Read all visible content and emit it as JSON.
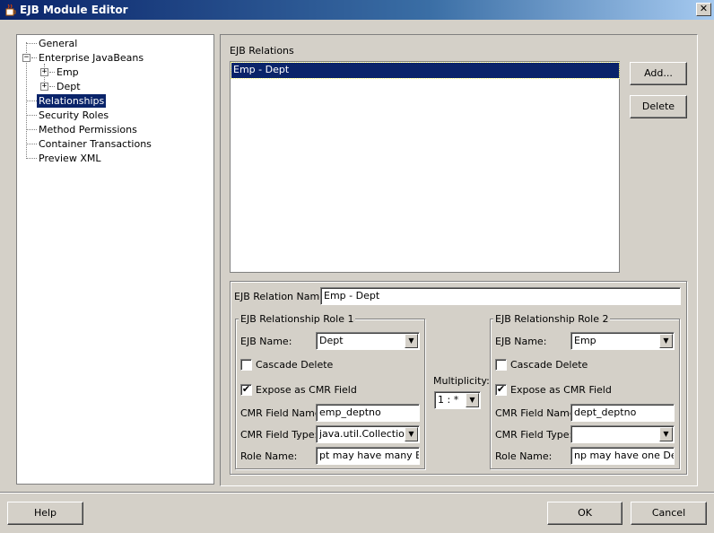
{
  "window": {
    "title": "EJB Module Editor",
    "close_glyph": "✕"
  },
  "tree": {
    "items": [
      {
        "label": "General"
      },
      {
        "label": "Enterprise JavaBeans",
        "expander": "−"
      },
      {
        "label": "Emp",
        "expander": "+"
      },
      {
        "label": "Dept",
        "expander": "+"
      },
      {
        "label": "Relationships",
        "selected": true
      },
      {
        "label": "Security Roles"
      },
      {
        "label": "Method Permissions"
      },
      {
        "label": "Container Transactions"
      },
      {
        "label": "Preview XML"
      }
    ]
  },
  "relations": {
    "header": "EJB Relations",
    "items": [
      "Emp - Dept"
    ],
    "add_label": "Add...",
    "delete_label": "Delete"
  },
  "relation_name": {
    "label": "EJB Relation Name:",
    "value": "Emp - Dept"
  },
  "role1": {
    "title": "EJB Relationship Role 1",
    "ejb_name_label": "EJB Name:",
    "ejb_name_value": "Dept",
    "cascade_label": "Cascade Delete",
    "cascade_checked": false,
    "expose_label": "Expose as CMR Field",
    "expose_checked": true,
    "cmr_name_label": "CMR Field Name:",
    "cmr_name_value": "emp_deptno",
    "cmr_type_label": "CMR Field Type:",
    "cmr_type_value": "java.util.Collection",
    "role_name_label": "Role Name:",
    "role_name_value": "pt may have many Emp"
  },
  "multiplicity": {
    "label": "Multiplicity:",
    "value": "1 : *"
  },
  "role2": {
    "title": "EJB Relationship Role 2",
    "ejb_name_label": "EJB Name:",
    "ejb_name_value": "Emp",
    "cascade_label": "Cascade Delete",
    "cascade_checked": false,
    "expose_label": "Expose as CMR Field",
    "expose_checked": true,
    "cmr_name_label": "CMR Field Name:",
    "cmr_name_value": "dept_deptno",
    "cmr_type_label": "CMR Field Type:",
    "cmr_type_value": "",
    "role_name_label": "Role Name:",
    "role_name_value": "np may have one Dept"
  },
  "footer": {
    "help_label": "Help",
    "ok_label": "OK",
    "cancel_label": "Cancel"
  },
  "glyphs": {
    "check": "✔",
    "down_arrow": "▼"
  }
}
